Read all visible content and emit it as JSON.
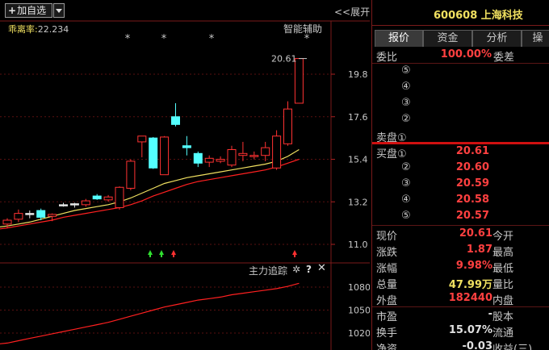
{
  "toolbar": {
    "add_label": "加自选",
    "expand_label": "<<展开",
    "smart_label": "智能辅助"
  },
  "indicator": {
    "label": "乖离率:",
    "value": "22.234"
  },
  "markers": [
    "*",
    "*",
    "*",
    "*"
  ],
  "chart_data": {
    "type": "candlestick",
    "y_ticks": [
      "19.8",
      "17.6",
      "15.4",
      "13.2",
      "11.0"
    ],
    "y_tick_values": [
      19.8,
      17.6,
      15.4,
      13.2,
      11.0
    ],
    "price_annotation": "20.61",
    "sub_y_ticks": [
      "1080",
      "1050",
      "1020"
    ],
    "sub_y_tick_values": [
      1080,
      1050,
      1020
    ],
    "candles": [
      {
        "o": 12.05,
        "h": 12.35,
        "l": 11.85,
        "c": 12.25,
        "color": "red"
      },
      {
        "o": 12.3,
        "h": 12.8,
        "l": 12.15,
        "c": 12.6,
        "color": "red"
      },
      {
        "o": 12.6,
        "h": 12.75,
        "l": 12.35,
        "c": 12.6,
        "color": "white"
      },
      {
        "o": 12.75,
        "h": 12.85,
        "l": 12.25,
        "c": 12.4,
        "color": "cyan"
      },
      {
        "o": 12.45,
        "h": 12.6,
        "l": 12.2,
        "c": 12.55,
        "color": "red"
      },
      {
        "o": 13.05,
        "h": 13.15,
        "l": 12.95,
        "c": 13.05,
        "color": "white"
      },
      {
        "o": 13.05,
        "h": 13.15,
        "l": 12.9,
        "c": 13.1,
        "color": "white"
      },
      {
        "o": 13.05,
        "h": 13.35,
        "l": 12.95,
        "c": 13.25,
        "color": "red"
      },
      {
        "o": 13.5,
        "h": 13.6,
        "l": 13.3,
        "c": 13.35,
        "color": "cyan"
      },
      {
        "o": 13.3,
        "h": 13.55,
        "l": 13.2,
        "c": 13.45,
        "color": "red"
      },
      {
        "o": 12.9,
        "h": 14.0,
        "l": 12.8,
        "c": 13.95,
        "color": "red"
      },
      {
        "o": 13.9,
        "h": 15.4,
        "l": 13.8,
        "c": 15.3,
        "color": "red"
      },
      {
        "o": 16.3,
        "h": 16.6,
        "l": 15.5,
        "c": 16.6,
        "color": "red"
      },
      {
        "o": 16.5,
        "h": 16.55,
        "l": 14.9,
        "c": 14.95,
        "color": "cyan"
      },
      {
        "o": 14.6,
        "h": 16.6,
        "l": 14.6,
        "c": 16.55,
        "color": "red"
      },
      {
        "o": 17.6,
        "h": 18.3,
        "l": 17.1,
        "c": 17.2,
        "color": "cyan"
      },
      {
        "o": 16.1,
        "h": 16.6,
        "l": 15.6,
        "c": 16.0,
        "color": "cyan"
      },
      {
        "o": 15.7,
        "h": 15.8,
        "l": 15.0,
        "c": 15.2,
        "color": "cyan"
      },
      {
        "o": 15.25,
        "h": 15.6,
        "l": 15.0,
        "c": 15.45,
        "color": "red"
      },
      {
        "o": 15.3,
        "h": 15.55,
        "l": 15.2,
        "c": 15.4,
        "color": "red"
      },
      {
        "o": 15.1,
        "h": 16.1,
        "l": 15.0,
        "c": 15.9,
        "color": "red"
      },
      {
        "o": 15.6,
        "h": 16.3,
        "l": 15.3,
        "c": 15.7,
        "color": "red"
      },
      {
        "o": 15.6,
        "h": 15.8,
        "l": 15.4,
        "c": 15.6,
        "color": "red"
      },
      {
        "o": 15.6,
        "h": 16.3,
        "l": 15.3,
        "c": 16.0,
        "color": "red"
      },
      {
        "o": 14.95,
        "h": 16.9,
        "l": 14.85,
        "c": 16.6,
        "color": "red"
      },
      {
        "o": 16.2,
        "h": 18.4,
        "l": 16.1,
        "c": 18.0,
        "color": "red"
      },
      {
        "o": 18.3,
        "h": 20.61,
        "l": 18.3,
        "c": 20.61,
        "color": "red"
      }
    ],
    "ma_yellow": [
      11.95,
      12.05,
      12.15,
      12.3,
      12.45,
      12.6,
      12.75,
      12.85,
      12.95,
      13.05,
      13.2,
      13.4,
      13.65,
      13.9,
      14.15,
      14.3,
      14.45,
      14.55,
      14.65,
      14.75,
      14.85,
      14.95,
      15.05,
      15.15,
      15.3,
      15.55,
      15.9
    ],
    "ma_red": [
      11.85,
      11.95,
      12.05,
      12.15,
      12.25,
      12.4,
      12.5,
      12.6,
      12.7,
      12.8,
      12.9,
      13.05,
      13.25,
      13.5,
      13.7,
      13.9,
      14.1,
      14.25,
      14.35,
      14.45,
      14.55,
      14.65,
      14.75,
      14.85,
      15.0,
      15.2,
      15.4
    ],
    "sub_series": [
      1007,
      1010,
      1013,
      1016,
      1019,
      1022,
      1025,
      1028,
      1031,
      1034,
      1038,
      1042,
      1046,
      1050,
      1054,
      1057,
      1060,
      1063,
      1065,
      1067,
      1070,
      1072,
      1074,
      1076,
      1078,
      1081,
      1085
    ]
  },
  "sub_panel": {
    "title": "主力追踪",
    "gear": "✲",
    "help": "?",
    "close": "✕"
  },
  "panel": {
    "stock_title": "600608 上海科技",
    "tabs": [
      "报价",
      "资金",
      "分析",
      "操"
    ],
    "weibi": {
      "label": "委比",
      "value": "100.00%",
      "label2": "委差"
    },
    "sell_circles": [
      "⑤",
      "④",
      "③",
      "②"
    ],
    "sell_label": "卖盘①",
    "buy": [
      {
        "label": "买盘①",
        "price": "20.61"
      },
      {
        "label": "②",
        "price": "20.60"
      },
      {
        "label": "③",
        "price": "20.59"
      },
      {
        "label": "④",
        "price": "20.58"
      },
      {
        "label": "⑤",
        "price": "20.57"
      }
    ],
    "stats": [
      {
        "l": "现价",
        "v": "20.61",
        "vc": "red",
        "r": "今开"
      },
      {
        "l": "涨跌",
        "v": "1.87",
        "vc": "red",
        "r": "最高"
      },
      {
        "l": "涨幅",
        "v": "9.98%",
        "vc": "red",
        "r": "最低"
      },
      {
        "l": "总量",
        "v": "47.99万",
        "vc": "yel",
        "r": "量比"
      },
      {
        "l": "外盘",
        "v": "182440",
        "vc": "red",
        "r": "内盘"
      },
      {
        "l": "市盈",
        "v": "-",
        "vc": "wht",
        "r": "股本"
      },
      {
        "l": "换手",
        "v": "15.07%",
        "vc": "wht",
        "r": "流通"
      },
      {
        "l": "净资",
        "v": "-0.03",
        "vc": "wht",
        "r": "收益(三)"
      }
    ]
  }
}
